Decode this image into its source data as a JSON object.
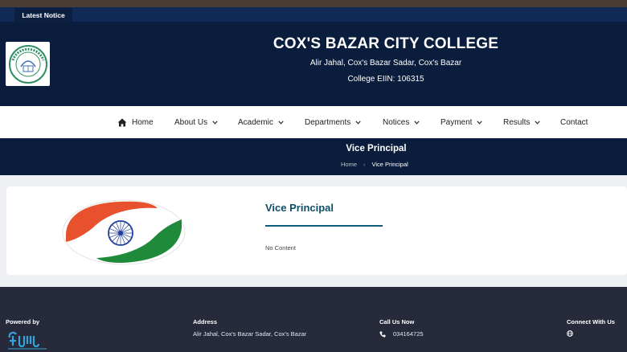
{
  "notice": {
    "label": "Latest Notice"
  },
  "header": {
    "college_name": "COX'S BAZAR CITY COLLEGE",
    "address": "Alir Jahal, Cox's Bazar Sadar, Cox's Bazar",
    "eiin": "College EIIN: 106315"
  },
  "nav": {
    "items": [
      {
        "label": "Home",
        "icon": "home-icon"
      },
      {
        "label": "About Us",
        "icon": "chevron-down-icon"
      },
      {
        "label": "Academic",
        "icon": "chevron-down-icon"
      },
      {
        "label": "Departments",
        "icon": "chevron-down-icon"
      },
      {
        "label": "Notices",
        "icon": "chevron-down-icon"
      },
      {
        "label": "Payment",
        "icon": "chevron-down-icon"
      },
      {
        "label": "Results",
        "icon": "chevron-down-icon"
      },
      {
        "label": "Contact"
      }
    ]
  },
  "banner": {
    "title": "Vice Principal",
    "breadcrumb": {
      "home": "Home",
      "current": "Vice Principal"
    }
  },
  "content": {
    "title": "Vice Principal",
    "body": "No Content"
  },
  "footer": {
    "powered_by": "Powered by",
    "address_heading": "Address",
    "address_text": "Alir Jahal, Cox's Bazar Sadar, Cox's Bazar",
    "call_heading": "Call Us Now",
    "phone": "034164725",
    "connect_heading": "Connect With Us"
  },
  "colors": {
    "navy": "#0b1d3d",
    "notice_bar": "#112a55",
    "accent_teal": "#0e4e67",
    "footer_bg": "#262a3b",
    "saffron": "#e8512e",
    "green": "#1f8a3a",
    "chakra_blue": "#1f3f9a"
  }
}
